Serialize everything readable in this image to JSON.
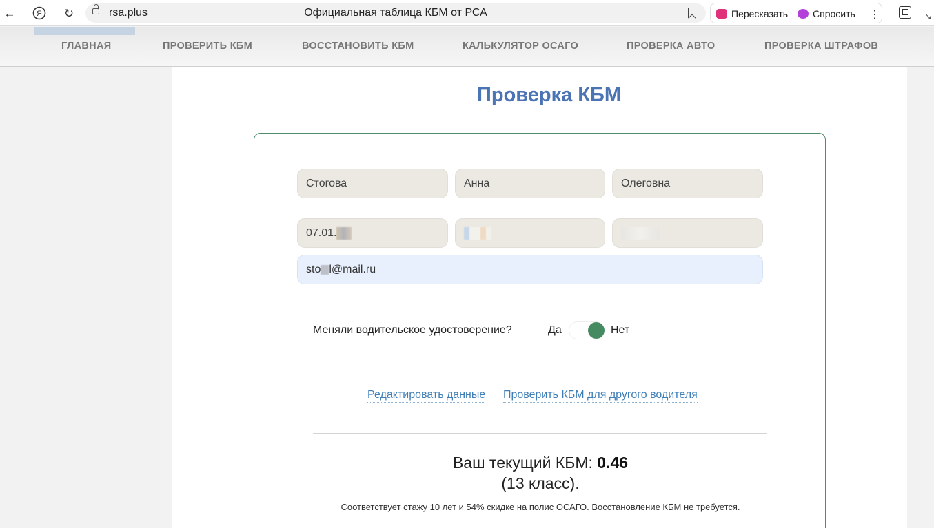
{
  "browser": {
    "domain": "rsa.plus",
    "page_title": "Официальная таблица КБМ от РСА",
    "summarize_label": "Пересказать",
    "ask_label": "Спросить"
  },
  "nav": {
    "items": [
      "ГЛАВНАЯ",
      "ПРОВЕРИТЬ КБМ",
      "ВОССТАНОВИТЬ КБМ",
      "КАЛЬКУЛЯТОР ОСАГО",
      "ПРОВЕРКА АВТО",
      "ПРОВЕРКА ШТРАФОВ"
    ]
  },
  "page": {
    "heading": "Проверка КБМ"
  },
  "form": {
    "last_name": "Стогова",
    "first_name": "Анна",
    "middle_name": "Олеговна",
    "birth_date_prefix": "07.01.",
    "email_prefix": "sto",
    "email_suffix": "l@mail.ru",
    "question": "Меняли водительское удостоверение?",
    "yes_label": "Да",
    "no_label": "Нет"
  },
  "links": {
    "edit": "Редактировать данные",
    "other_driver": "Проверить КБМ для другого водителя"
  },
  "result": {
    "prefix": "Ваш текущий КБМ: ",
    "value": "0.46",
    "class_text": "(13 класс).",
    "note": "Соответствует стажу 10 лет и 54% скидке на полис ОСАГО. Восстановление КБМ не требуется."
  },
  "colors": {
    "heading": "#4a74b4",
    "card_border": "#4f8b6d",
    "toggle": "#468a61",
    "link": "#3f7eb7"
  }
}
